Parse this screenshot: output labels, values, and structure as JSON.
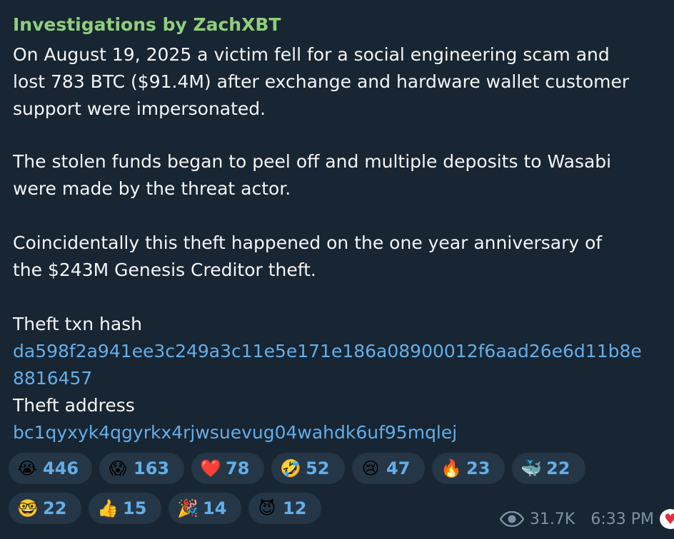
{
  "channel": {
    "name": "Investigations by ZachXBT"
  },
  "post": {
    "paragraph1": [
      "On August 19, 2025 a victim fell for a social engineering scam and",
      "lost 783 BTC ($91.4M) after exchange and hardware wallet customer",
      "support were impersonated."
    ],
    "paragraph2": [
      "The stolen funds began to peel off and multiple deposits to Wasabi",
      "were made by the threat actor."
    ],
    "paragraph3": [
      "Coincidentally this theft happened on the one year anniversary of",
      "the $243M Genesis Creditor theft."
    ],
    "txn_label": "Theft txn hash",
    "txn_hash_line1": "da598f2a941ee3c249a3c11e5e171e186a08900012f6aad26e6d11b8e",
    "txn_hash_line2": "8816457",
    "address_label": "Theft address",
    "address": "bc1qyxyk4qgyrkx4rjwsuevug04wahdk6uf95mqlej"
  },
  "reactions": [
    {
      "emoji": "😭",
      "icon": "loudly-crying-face-icon",
      "count": "446"
    },
    {
      "emoji": "😱",
      "icon": "screaming-face-icon",
      "count": "163"
    },
    {
      "emoji": "❤️",
      "icon": "red-heart-icon",
      "count": "78"
    },
    {
      "emoji": "🤣",
      "icon": "rolling-on-floor-laughing-icon",
      "count": "52"
    },
    {
      "emoji": "😢",
      "icon": "crying-face-icon",
      "count": "47"
    },
    {
      "emoji": "🔥",
      "icon": "fire-icon",
      "count": "23"
    },
    {
      "emoji": "🐳",
      "icon": "whale-icon",
      "count": "22"
    },
    {
      "emoji": "🤓",
      "icon": "nerd-face-icon",
      "count": "22"
    },
    {
      "emoji": "👍",
      "icon": "thumbs-up-icon",
      "count": "15"
    },
    {
      "emoji": "🎉",
      "icon": "party-popper-icon",
      "count": "14"
    },
    {
      "emoji": "😈",
      "icon": "smiling-devil-icon",
      "count": "12"
    }
  ],
  "meta": {
    "views": "31.7K",
    "time": "6:33 PM"
  },
  "colors": {
    "background": "#182533",
    "channel_name": "#8fce7b",
    "text": "#f5f5f5",
    "link": "#63aee8",
    "reaction_bg": "#253747",
    "meta": "#7f91a4"
  }
}
